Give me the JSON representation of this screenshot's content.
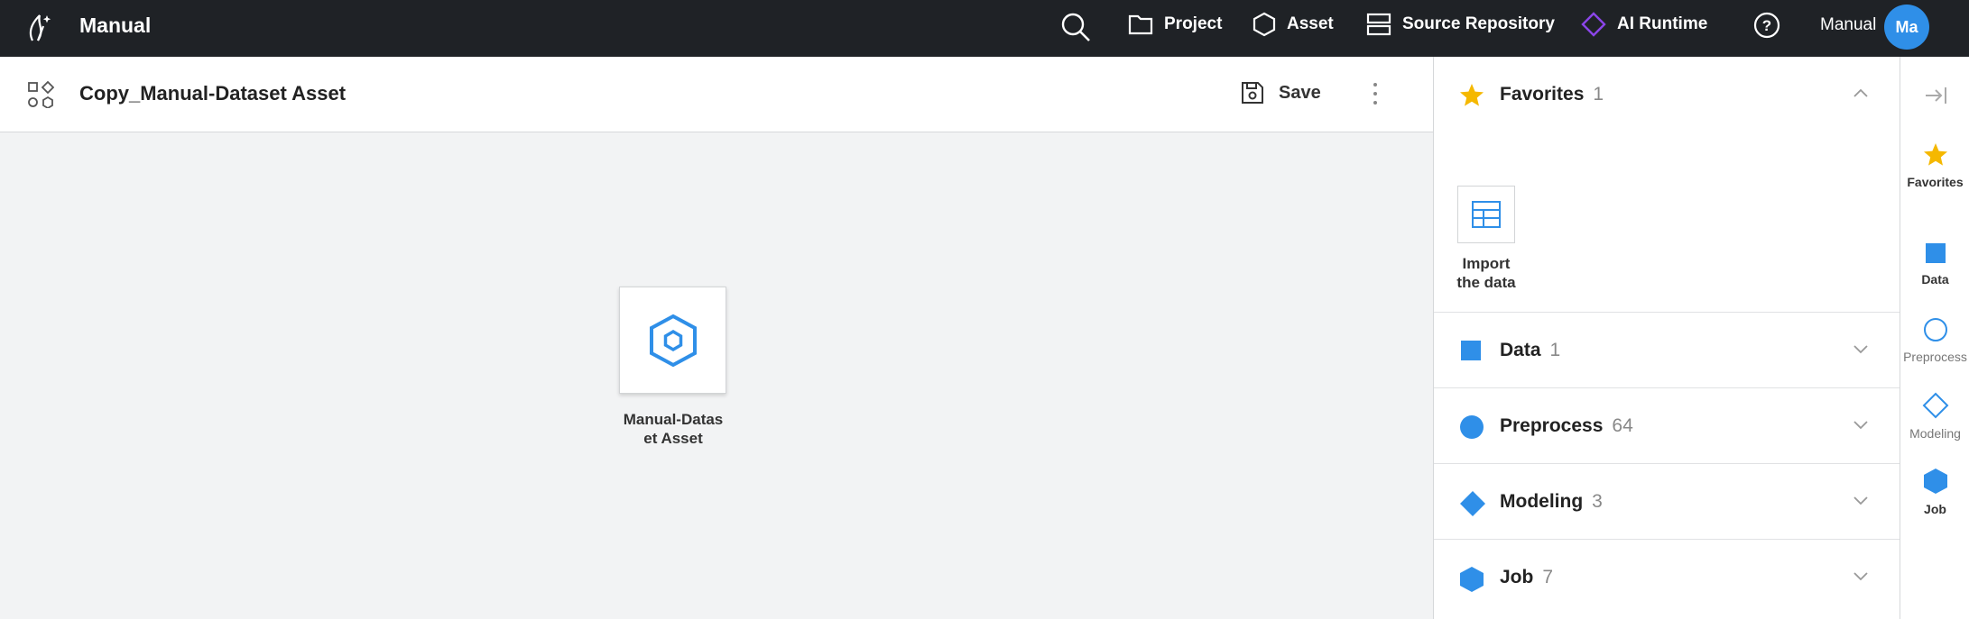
{
  "app": {
    "brand": "Manual"
  },
  "nav": {
    "items": [
      {
        "label": "Project",
        "icon": "folder-icon"
      },
      {
        "label": "Asset",
        "icon": "hexagon-icon"
      },
      {
        "label": "Source Repository",
        "icon": "server-icon"
      },
      {
        "label": "AI Runtime",
        "icon": "diamond-icon"
      }
    ],
    "user": "Manual",
    "avatar": "Ma"
  },
  "editor": {
    "title": "Copy_Manual-Dataset Asset",
    "save_label": "Save"
  },
  "canvas": {
    "node": {
      "label": "Manual-Datas\net Asset",
      "icon": "hexagon-icon"
    }
  },
  "panel": {
    "favorites": {
      "name": "Favorites",
      "count": "1",
      "tile_label": "Import\nthe data"
    },
    "sections": [
      {
        "name": "Data",
        "count": "1"
      },
      {
        "name": "Preprocess",
        "count": "64"
      },
      {
        "name": "Modeling",
        "count": "3"
      },
      {
        "name": "Job",
        "count": "7"
      }
    ]
  },
  "rail": {
    "items": [
      {
        "label": "Favorites"
      },
      {
        "label": "Data"
      },
      {
        "label": "Preprocess"
      },
      {
        "label": "Modeling"
      },
      {
        "label": "Job"
      }
    ]
  },
  "colors": {
    "accent": "#2f8fe8",
    "star": "#f5b800",
    "topbar": "#1f2226",
    "runtime": "#8b45e8"
  }
}
